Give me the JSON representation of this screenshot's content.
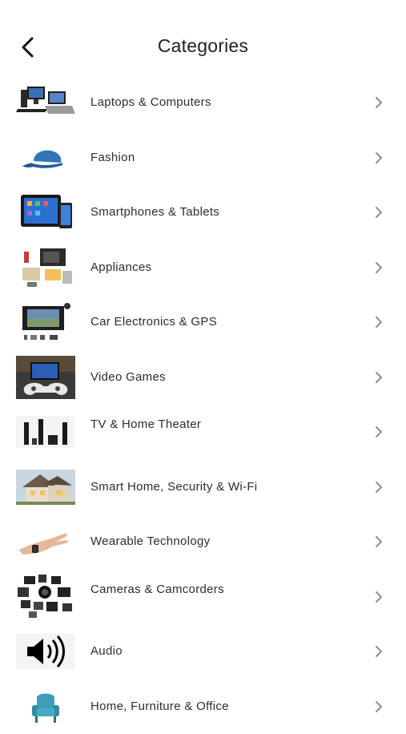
{
  "header": {
    "title": "Categories",
    "back_icon": "chevron-left-icon"
  },
  "categories": [
    {
      "label": "Laptops & Computers",
      "icon": "laptop-computer-icon"
    },
    {
      "label": "Fashion",
      "icon": "cap-icon"
    },
    {
      "label": "Smartphones & Tablets",
      "icon": "tablet-phone-icon"
    },
    {
      "label": "Appliances",
      "icon": "appliances-icon"
    },
    {
      "label": "Car Electronics & GPS",
      "icon": "car-stereo-icon"
    },
    {
      "label": "Video Games",
      "icon": "game-controller-icon"
    },
    {
      "label": "TV & Home Theater",
      "icon": "speakers-icon"
    },
    {
      "label": "Smart Home, Security & Wi-Fi",
      "icon": "house-icon"
    },
    {
      "label": "Wearable Technology",
      "icon": "smartwatch-hand-icon"
    },
    {
      "label": "Cameras & Camcorders",
      "icon": "cameras-icon"
    },
    {
      "label": "Audio",
      "icon": "speaker-volume-icon"
    },
    {
      "label": "Home, Furniture & Office",
      "icon": "armchair-icon"
    }
  ],
  "row_chevron_icon": "chevron-right-icon",
  "colors": {
    "background": "#ffffff",
    "text": "#2d2d2d",
    "chevron": "#8e8e8e"
  }
}
